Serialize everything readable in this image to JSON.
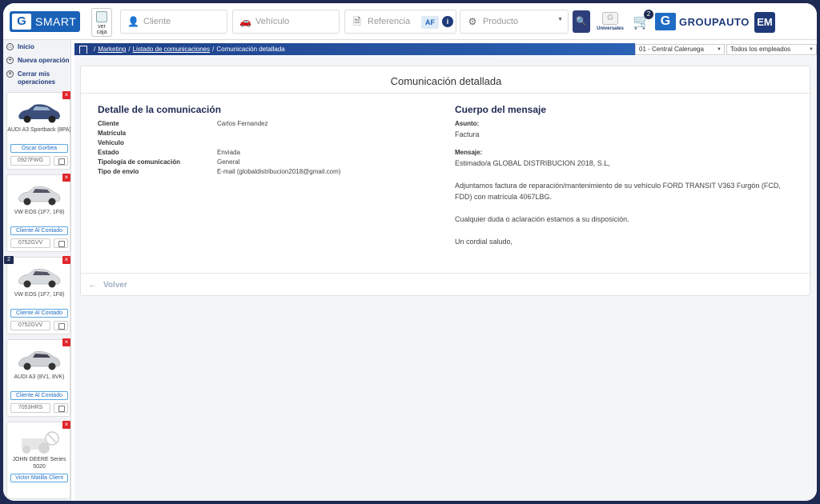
{
  "header": {
    "logo_text": "SMART",
    "ver_caja": "ver caja",
    "cliente_placeholder": "Cliente",
    "vehiculo_placeholder": "Vehículo",
    "referencia_placeholder": "Referencia",
    "af_label": "AF",
    "producto_placeholder": "Producto",
    "universales_label": "Universales",
    "cart_count": "2",
    "brand": "GROUPAUTO",
    "user_initials": "EM"
  },
  "sidebar": {
    "nav": [
      {
        "label": "Inicio"
      },
      {
        "label": "Nueva operación"
      },
      {
        "label": "Cerrar mis operaciones"
      }
    ],
    "cards": [
      {
        "model": "AUDI A3 Sportback (8PA)",
        "client": "Oscar Gorbea",
        "plate": "0927FWG",
        "badge": "",
        "color": "#3b4f7a"
      },
      {
        "model": "VW EOS (1F7, 1F8)",
        "client": "Cliente Al Contado",
        "plate": "0752GVV",
        "badge": "",
        "color": "#d9dcdf"
      },
      {
        "model": "VW EOS (1F7, 1F8)",
        "client": "Cliente Al Contado",
        "plate": "0752GVV",
        "badge": "2",
        "color": "#d9dcdf"
      },
      {
        "model": "AUDI A3 (8V1, 8VK)",
        "client": "Cliente Al Contado",
        "plate": "7053HRS",
        "badge": "",
        "color": "#d0d3d6"
      },
      {
        "model": "JOHN DEERE Series 5020",
        "client": "Victor Matilla Client",
        "plate": "",
        "badge": "",
        "color": "#e6e6e6"
      }
    ]
  },
  "breadcrumb": {
    "items": [
      "Marketing",
      "Listado de comunicaciones",
      "Comunicación detallada"
    ]
  },
  "filters": {
    "center": "01 - Central Caleruega",
    "employees": "Todos los empleados"
  },
  "page": {
    "title": "Comunicación detallada",
    "detail_title": "Detalle de la comunicación",
    "details": [
      {
        "label": "Cliente",
        "value": "Carlos Fernandez"
      },
      {
        "label": "Matrícula",
        "value": ""
      },
      {
        "label": "Vehículo",
        "value": ""
      },
      {
        "label": "Estado",
        "value": "Enviada"
      },
      {
        "label": "Tipología de comunicación",
        "value": "General"
      },
      {
        "label": "Tipo de envío",
        "value": "E-mail (globaldistribucion2018@gmail.com)"
      }
    ],
    "body_title": "Cuerpo del mensaje",
    "subject_label": "Asunto:",
    "subject": "Factura",
    "message_label": "Mensaje:",
    "message_lines": [
      "Estimado/a GLOBAL DISTRIBUCION 2018, S.L,",
      "Adjuntamos factura de reparación/mantenimiento de su vehículo FORD TRANSIT V363 Furgón (FCD, FDD) con matrícula 4067LBG.",
      "Cualquier duda o aclaración estamos a su disposición.",
      "Un cordial saludo,"
    ],
    "back_label": "Volver"
  }
}
